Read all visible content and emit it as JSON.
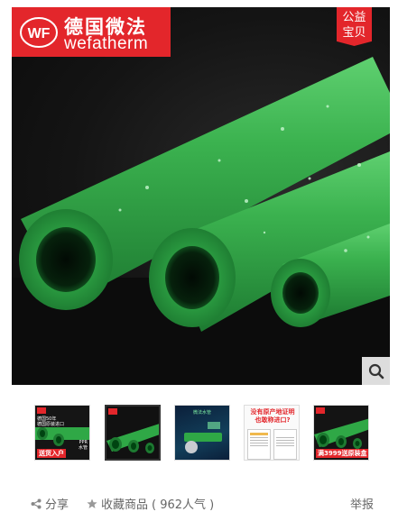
{
  "brand": {
    "mark": "WF",
    "name_cn": "德国微法",
    "name_en": "wefatherm"
  },
  "badge": {
    "line1": "公益",
    "line2": "宝贝"
  },
  "zoom": {
    "icon": "search-icon"
  },
  "thumbnails": [
    {
      "promo_top": "德国50年",
      "promo_mid": "德国原装进口",
      "promo_bottom": "送货入户",
      "side_tag_1": "PPR",
      "side_tag_2": "水管"
    },
    {},
    {
      "title": "微法水管"
    },
    {
      "title_line1": "没有原产地证明",
      "title_line2": "也敢称进口?"
    },
    {
      "promo_bottom": "满3999送原装盒"
    }
  ],
  "actions": {
    "share_label": "分享",
    "favorite_label": "收藏商品",
    "favorite_count": "( 962人气 )",
    "report_label": "举报"
  },
  "colors": {
    "brand_red": "#e3262b",
    "pipe_green": "#2fa846",
    "background": "#111111"
  }
}
